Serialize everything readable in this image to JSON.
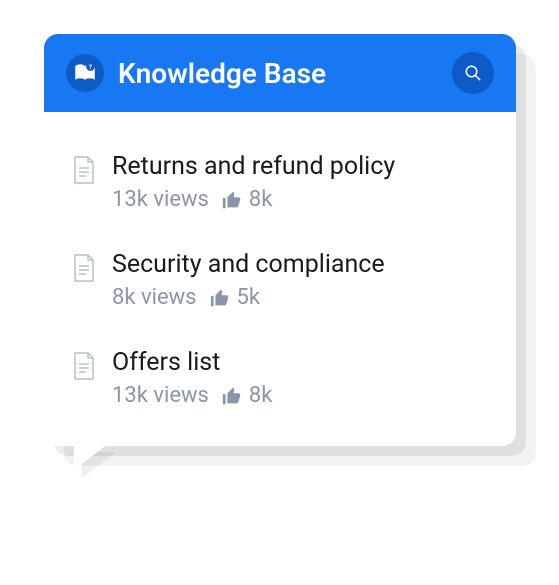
{
  "header": {
    "title": "Knowledge Base"
  },
  "articles": [
    {
      "title": "Returns and refund policy",
      "views": "13k views",
      "likes": "8k"
    },
    {
      "title": "Security and compliance",
      "views": "8k views",
      "likes": "5k"
    },
    {
      "title": "Offers list",
      "views": "13k views",
      "likes": "8k"
    }
  ]
}
